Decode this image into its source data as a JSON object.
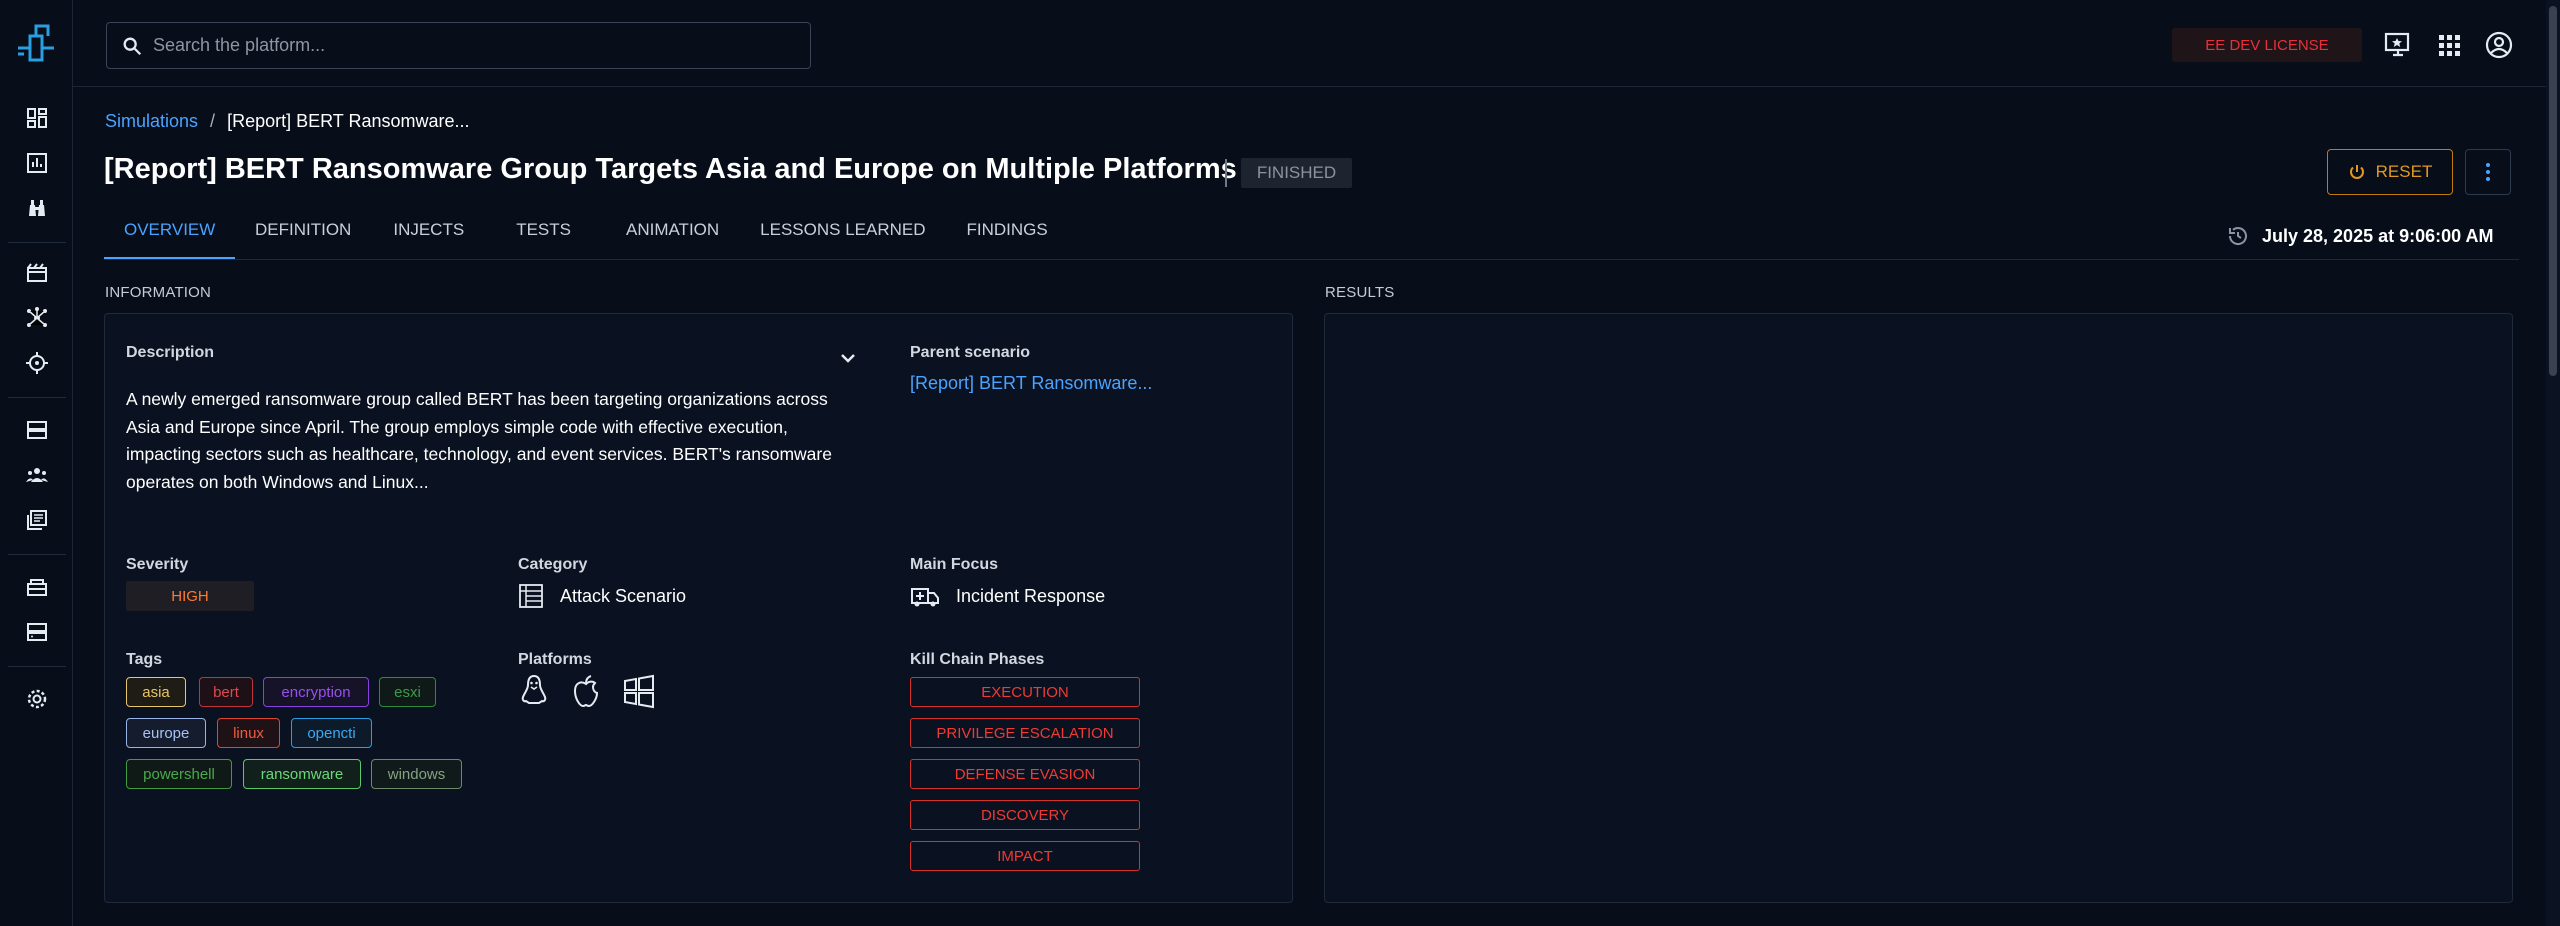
{
  "app": {
    "search_placeholder": "Search the platform...",
    "license_label": "EE DEV LICENSE"
  },
  "sidebar": {
    "items": [
      {
        "icon": "dashboard-icon"
      },
      {
        "icon": "chart-icon"
      },
      {
        "icon": "binoculars-icon"
      },
      {
        "icon": "movie-icon"
      },
      {
        "icon": "hub-icon"
      },
      {
        "icon": "crosshair-icon"
      },
      {
        "icon": "server-icon"
      },
      {
        "icon": "teams-icon"
      },
      {
        "icon": "library-icon"
      },
      {
        "icon": "assets-icon"
      },
      {
        "icon": "storage-icon"
      },
      {
        "icon": "settings-icon"
      }
    ]
  },
  "breadcrumb": {
    "parent": "Simulations",
    "separator": "/",
    "current": "[Report] BERT Ransomware..."
  },
  "header": {
    "title": "[Report] BERT Ransomware Group Targets Asia and Europe on Multiple Platforms",
    "status": "FINISHED",
    "reset_label": "RESET"
  },
  "tabs": [
    {
      "label": "OVERVIEW",
      "active": true
    },
    {
      "label": "DEFINITION",
      "active": false
    },
    {
      "label": "INJECTS",
      "active": false
    },
    {
      "label": "TESTS",
      "active": false
    },
    {
      "label": "ANIMATION",
      "active": false
    },
    {
      "label": "LESSONS LEARNED",
      "active": false
    },
    {
      "label": "FINDINGS",
      "active": false
    }
  ],
  "date": "July 28, 2025 at 9:06:00 AM",
  "information": {
    "section_label": "INFORMATION",
    "description_label": "Description",
    "description_lines": [
      "A newly emerged ransomware group called BERT has been targeting organizations across",
      "Asia and Europe since April. The group employs simple code with effective execution,",
      "impacting sectors such as healthcare, technology, and event services. BERT's ransomware",
      "operates on both Windows and Linux..."
    ],
    "parent_scenario_label": "Parent scenario",
    "parent_scenario_value": "[Report] BERT Ransomware...",
    "severity_label": "Severity",
    "severity_value": "HIGH",
    "category_label": "Category",
    "category_value": "Attack Scenario",
    "main_focus_label": "Main Focus",
    "main_focus_value": "Incident Response",
    "tags_label": "Tags",
    "tags": [
      {
        "label": "asia",
        "color": "#e8c46a"
      },
      {
        "label": "bert",
        "color": "#c2323a"
      },
      {
        "label": "encryption",
        "color": "#8a3fe0"
      },
      {
        "label": "esxi",
        "color": "#2f8a3c"
      },
      {
        "label": "europe",
        "color": "#9ab4e8"
      },
      {
        "label": "linux",
        "color": "#e0462f"
      },
      {
        "label": "opencti",
        "color": "#2a9ee0"
      },
      {
        "label": "powershell",
        "color": "#3f9a42"
      },
      {
        "label": "ransomware",
        "color": "#5cc86a"
      },
      {
        "label": "windows",
        "color": "#6c8a6a"
      }
    ],
    "platforms_label": "Platforms",
    "platforms": [
      {
        "icon": "linux-icon"
      },
      {
        "icon": "apple-icon"
      },
      {
        "icon": "windows-icon"
      }
    ],
    "kill_chain_label": "Kill Chain Phases",
    "kill_chain_phases": [
      "EXECUTION",
      "PRIVILEGE ESCALATION",
      "DEFENSE EVASION",
      "DISCOVERY",
      "IMPACT"
    ]
  },
  "results": {
    "section_label": "RESULTS"
  },
  "colors": {
    "background": "#070d19",
    "accent": "#4aa3ff",
    "warning": "#e29922",
    "danger": "#f03a33"
  }
}
